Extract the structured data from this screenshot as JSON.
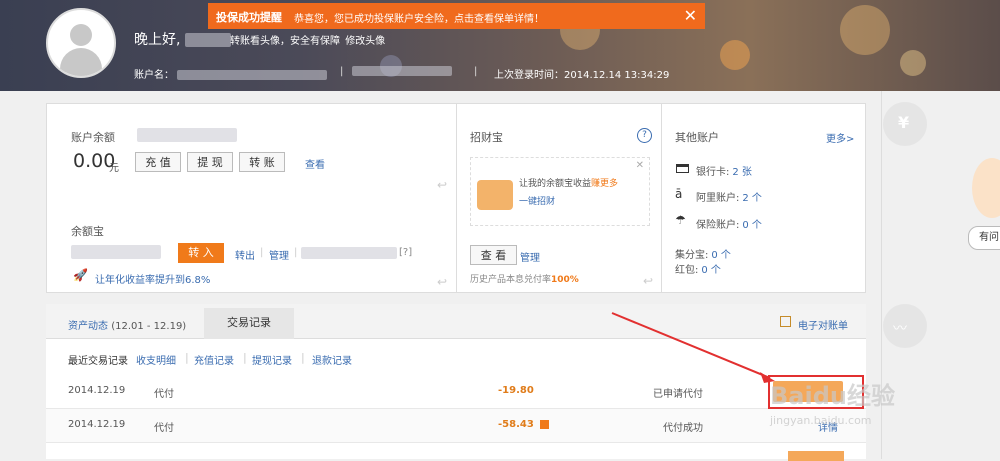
{
  "alert": {
    "title": "投保成功提醒",
    "message": "恭喜您，您已成功投保账户安全险，点击查看保单详情！"
  },
  "header": {
    "greeting": "晚上好,",
    "transfer_tip": "转账看头像，安全有保障",
    "modify_avatar": "修改头像",
    "account_label": "账户名：",
    "last_login": "上次登录时间：2014.12.14 13:34:29"
  },
  "balance": {
    "title": "账户余额",
    "amount": "0.00",
    "unit": "元",
    "buttons": [
      "充 值",
      "提 现",
      "转 账"
    ],
    "view": "查看"
  },
  "yuebao": {
    "title": "余额宝",
    "transfer_in": "转 入",
    "transfer_out": "转出",
    "manage": "管理",
    "help": "[?]",
    "promo": "让年化收益率提升到6.8%"
  },
  "zhaocai": {
    "title": "招财宝",
    "help": "?",
    "promo_line1_a": "让我的余额宝收益",
    "promo_line1_b": "赚更多",
    "promo_line2": "一键招财",
    "view": "查 看",
    "manage": "管理",
    "history_text": "历史产品本息兑付率",
    "history_rate": "100%"
  },
  "other": {
    "title": "其他账户",
    "more": "更多>",
    "bank_label": "银行卡:",
    "bank_value": "2 张",
    "ali_label": "阿里账户:",
    "ali_value": "2 个",
    "ins_label": "保险账户:",
    "ins_value": "0 个",
    "jifen_label": "集分宝:",
    "jifen_value": "0 个",
    "hongbao_label": "红包:",
    "hongbao_value": "0 个"
  },
  "tabs": {
    "asset": "资产动态",
    "asset_period": "(12.01 - 12.19)",
    "trade": "交易记录",
    "statement": "电子对账单"
  },
  "subtabs": [
    "最近交易记录",
    "收支明细",
    "充值记录",
    "提现记录",
    "退款记录"
  ],
  "rows": [
    {
      "date": "2014.12.19",
      "type": "代付",
      "amount": "-19.80",
      "status": "已申请代付"
    },
    {
      "date": "2014.12.19",
      "type": "代付",
      "amount": "-58.43",
      "status": "代付成功",
      "action": "详情"
    }
  ],
  "sidebar": {
    "yen": "¥",
    "ask": "有问"
  },
  "watermark": "Baidu经验",
  "watermark_url": "jingyan.baidu.com"
}
